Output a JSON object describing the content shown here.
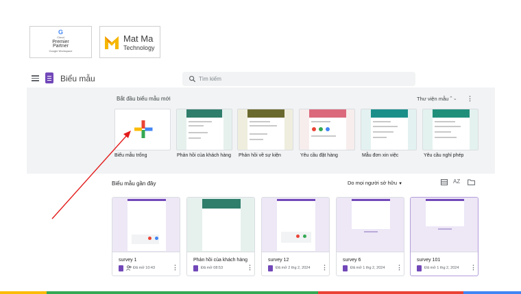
{
  "partners": {
    "google": {
      "g": "G",
      "cloud": "Cloud",
      "line1": "Premier",
      "line2": "Partner",
      "line3": "Google Workspace"
    },
    "matma": {
      "name1": "Mat Ma",
      "name2": "Technology"
    }
  },
  "header": {
    "app_title": "Biểu mẫu",
    "search_placeholder": "Tìm kiếm"
  },
  "templates": {
    "section_title": "Bắt đầu biểu mẫu mới",
    "gallery_label": "Thư viện mẫu",
    "items": [
      {
        "label": "Biểu mẫu trống",
        "header_color": "#ffffff"
      },
      {
        "label": "Phản hồi của khách hàng",
        "header_color": "#2f7d6b"
      },
      {
        "label": "Phản hồi về sự kiện",
        "header_color": "#6b6a2e"
      },
      {
        "label": "Yêu cầu đặt hàng",
        "header_color": "#c8102e"
      },
      {
        "label": "Mẫu đơn xin việc",
        "header_color": "#1a8f8a"
      },
      {
        "label": "Yêu cầu nghỉ phép",
        "header_color": "#1f8f7a"
      }
    ]
  },
  "recent": {
    "section_title": "Biểu mẫu gần đây",
    "owner_filter": "Do mọi người sở hữu",
    "sort_label": "AZ",
    "docs": [
      {
        "name": "survey 1",
        "meta": "Đã mở 10:43",
        "shared": true
      },
      {
        "name": "Phản hồi của khách hàng",
        "meta": "Đã mở 08:53",
        "shared": false
      },
      {
        "name": "survey 12",
        "meta": "Đã mở 2 thg 2, 2024",
        "shared": false
      },
      {
        "name": "survey 6",
        "meta": "Đã mở 1 thg 2, 2024",
        "shared": false
      },
      {
        "name": "survey 101",
        "meta": "Đã mở 1 thg 2, 2024",
        "shared": false
      }
    ]
  },
  "colors": {
    "accent": "#7248b9",
    "annotation_arrow": "#e31b1b",
    "band": "#f1f3f4"
  }
}
